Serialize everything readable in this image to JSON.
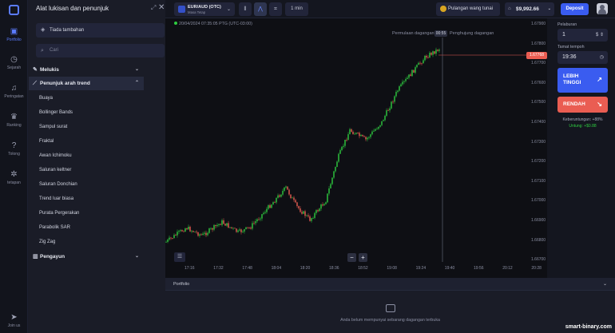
{
  "rail": {
    "items": [
      {
        "label": "Portfolio",
        "icon": "briefcase-icon",
        "active": true
      },
      {
        "label": "Sejarah",
        "icon": "clock-icon"
      },
      {
        "label": "Peringatan",
        "icon": "bell-icon"
      },
      {
        "label": "Ranking",
        "icon": "trophy-icon"
      },
      {
        "label": "Tolong",
        "icon": "help-icon"
      },
      {
        "label": "tetapan",
        "icon": "gear-icon"
      }
    ],
    "join": "Join us"
  },
  "panel": {
    "title": "Alat lukisan dan penunjuk",
    "no_addons": "Tiada tambahan",
    "search_placeholder": "Cari",
    "sections": {
      "drawing": "Melukis",
      "trend": "Penunjuk arah trend",
      "oscillators": "Pengayun"
    },
    "indicators": [
      "Buaya",
      "Bollinger Bands",
      "Sampul surat",
      "Fraktal",
      "Awan Ichimoku",
      "Saluran keltner",
      "Saluran Donchian",
      "Trend luar biasa",
      "Purata Pergerakan",
      "Parabolik SAR",
      "Zig Zag"
    ]
  },
  "topbar": {
    "asset_name": "EUR/AUD (OTC)",
    "asset_sub": "Masa Tetap",
    "timeframe": "1 min",
    "cashout": "Pulangan wang tunai",
    "balance": "$9,992.66",
    "deposit": "Deposit"
  },
  "chart": {
    "info": "20/04/2024  07:35:05 PTG  (UTC-03:00)",
    "start_label": "Permulaan dagangan",
    "clock": "00:55",
    "end_label": "Penghujung dagangan",
    "current_price": "1.67768",
    "y_ticks": [
      "1.67900",
      "1.67800",
      "1.67700",
      "1.67600",
      "1.67500",
      "1.67400",
      "1.67300",
      "1.67200",
      "1.67100",
      "1.67000",
      "1.66900",
      "1.66800",
      "1.66700"
    ],
    "x_ticks": [
      "17:16",
      "17:32",
      "17:48",
      "18:04",
      "18:20",
      "18:36",
      "18:52",
      "19:08",
      "19:24",
      "19:40",
      "19:56",
      "20:12",
      "20:28"
    ],
    "up_color": "#2ecc40",
    "down_color": "#ea5d52"
  },
  "trade": {
    "duration_label": "Pelaburan",
    "duration_value": "1",
    "expiry_label": "Tamat tempoh",
    "expiry_value": "19:36",
    "higher": "LEBIH TINGGI",
    "lower": "RENDAH",
    "profit_label": "Keberuntungan: +88%",
    "profit_value": "Untung: +$0.88"
  },
  "portfolio": {
    "title": "Portfolio",
    "empty": "Anda belum mempunyai sebarang dagangan terbuka"
  },
  "watermark": "smart-binary.com"
}
